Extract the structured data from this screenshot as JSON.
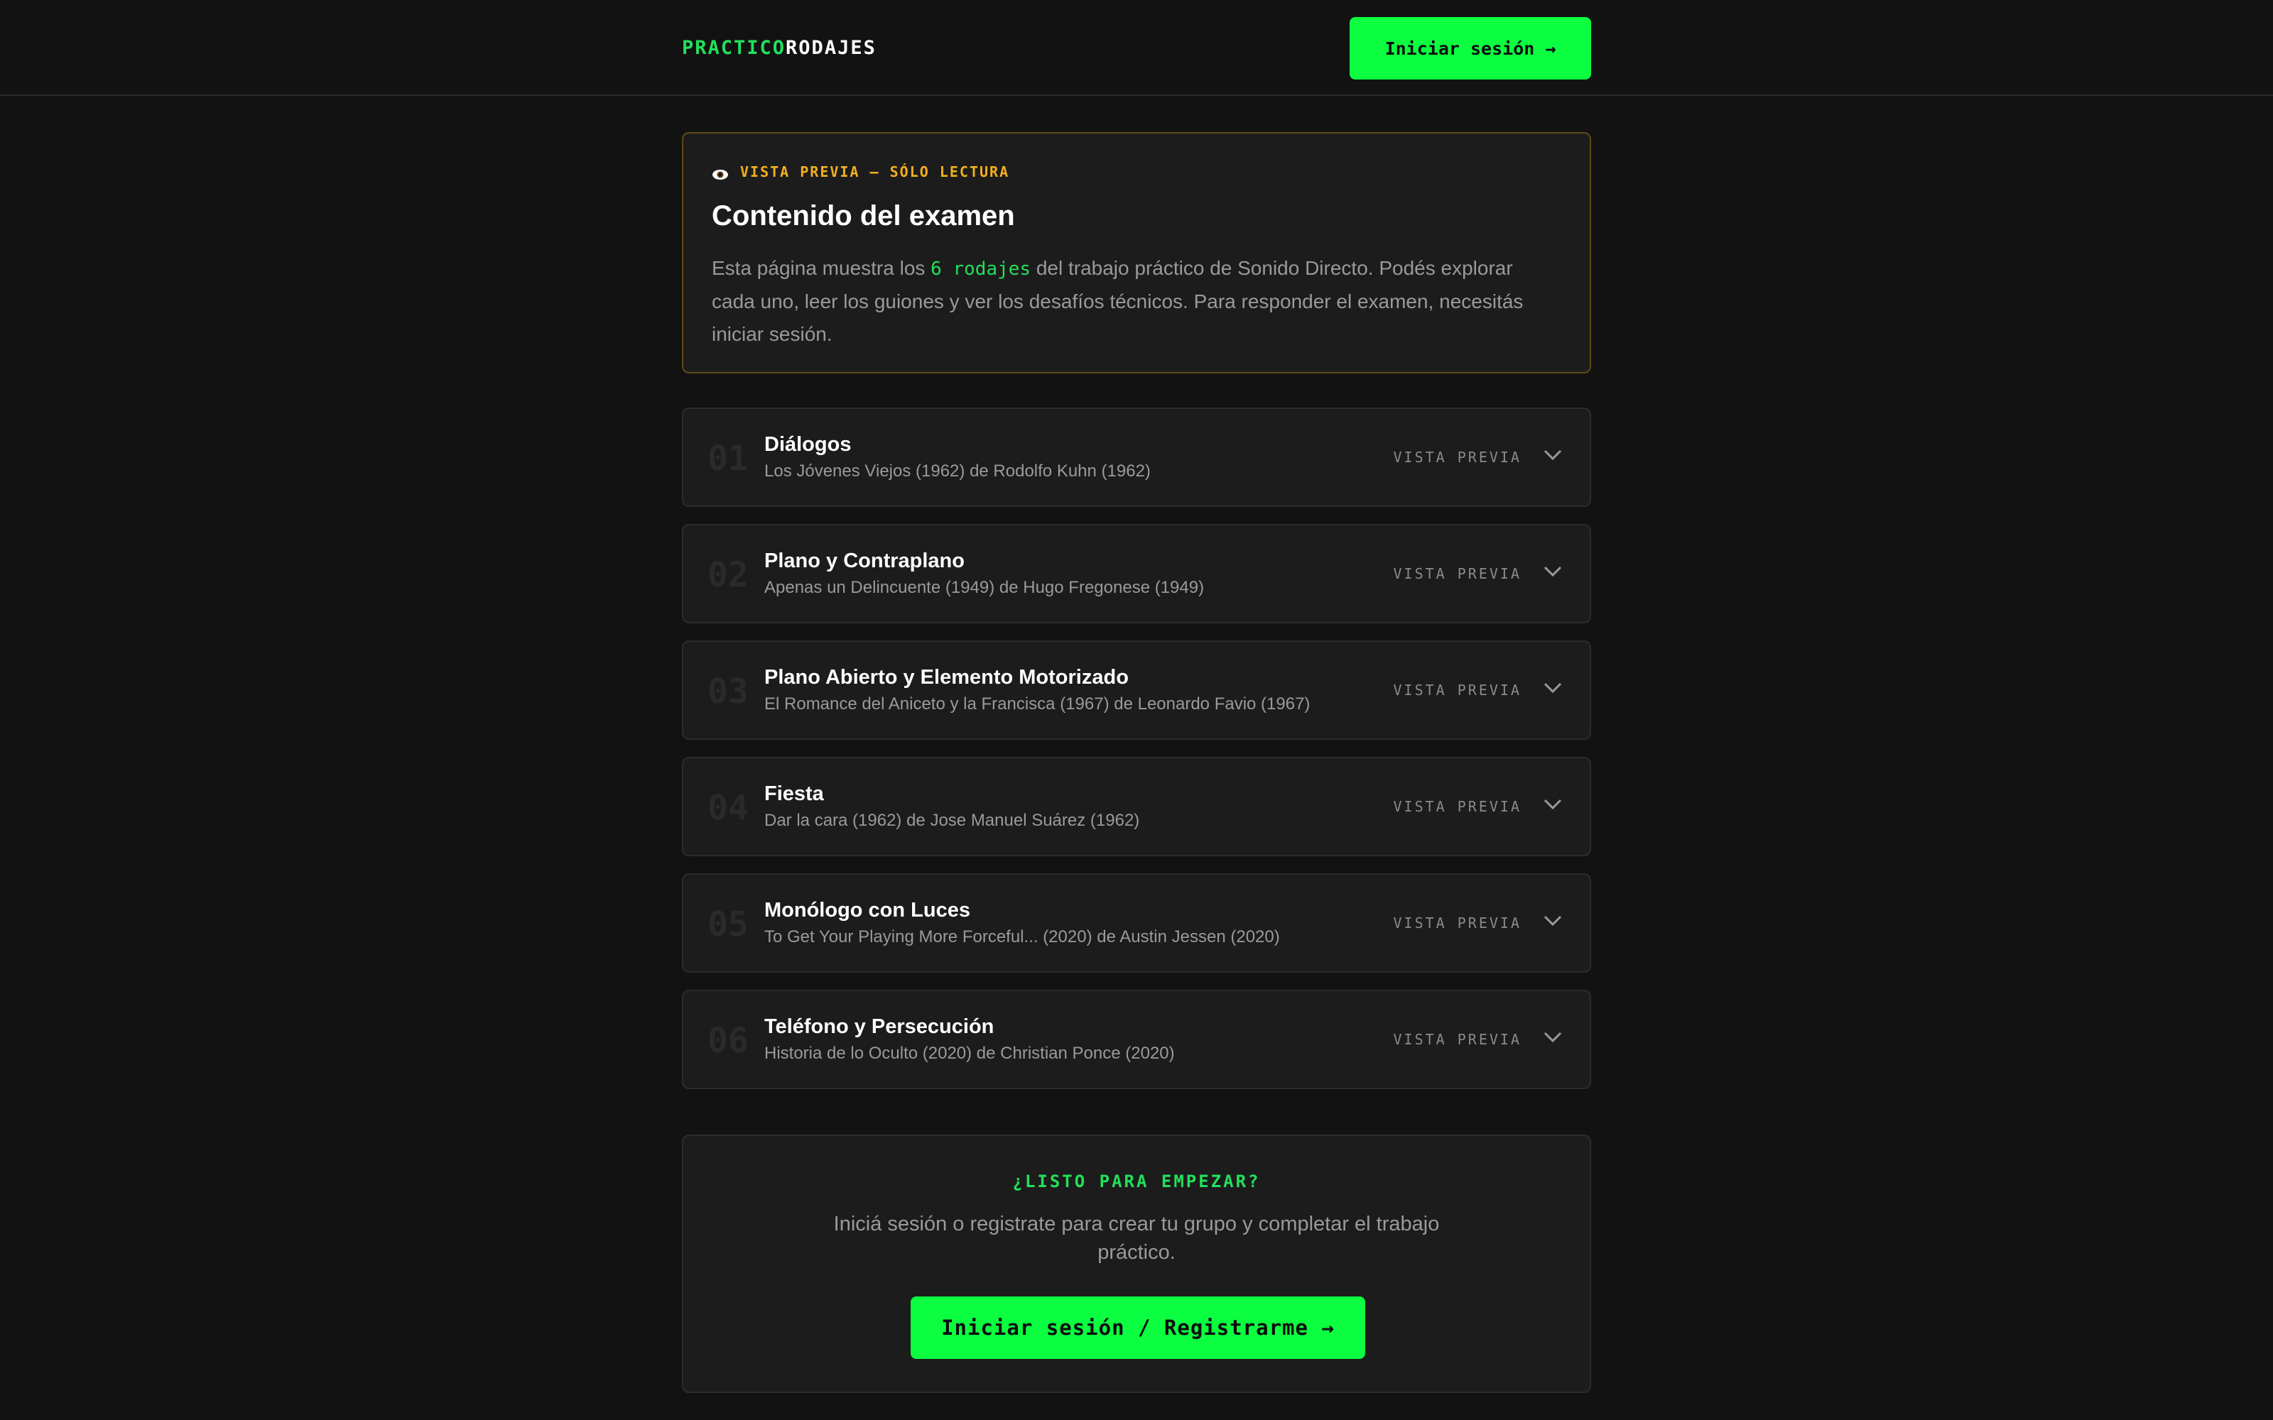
{
  "header": {
    "logo_part1": "PRACTICO",
    "logo_part2": "RODAJES",
    "login_label": "Iniciar sesión →"
  },
  "preview": {
    "tag": "VISTA PREVIA — SÓLO LECTURA",
    "tag_icon": "eye-icon",
    "title": "Contenido del examen",
    "desc_before": "Esta página muestra los ",
    "desc_highlight": "6 rodajes",
    "desc_after": " del trabajo práctico de Sonido Directo. Podés explorar cada uno, leer los guiones y ver los desafíos técnicos. Para responder el examen, necesitás iniciar sesión."
  },
  "items": [
    {
      "num": "01",
      "title": "Diálogos",
      "subtitle": "Los Jóvenes Viejos (1962) de Rodolfo Kuhn (1962)",
      "tag": "VISTA PREVIA"
    },
    {
      "num": "02",
      "title": "Plano y Contraplano",
      "subtitle": "Apenas un Delincuente (1949) de Hugo Fregonese (1949)",
      "tag": "VISTA PREVIA"
    },
    {
      "num": "03",
      "title": "Plano Abierto y Elemento Motorizado",
      "subtitle": "El Romance del Aniceto y la Francisca (1967) de Leonardo Favio (1967)",
      "tag": "VISTA PREVIA"
    },
    {
      "num": "04",
      "title": "Fiesta",
      "subtitle": "Dar la cara (1962) de Jose Manuel Suárez (1962)",
      "tag": "VISTA PREVIA"
    },
    {
      "num": "05",
      "title": "Monólogo con Luces",
      "subtitle": "To Get Your Playing More Forceful... (2020) de Austin Jessen (2020)",
      "tag": "VISTA PREVIA"
    },
    {
      "num": "06",
      "title": "Teléfono y Persecución",
      "subtitle": "Historia de lo Oculto (2020) de Christian Ponce (2020)",
      "tag": "VISTA PREVIA"
    }
  ],
  "cta": {
    "kicker": "¿LISTO PARA EMPEZAR?",
    "text": "Iniciá sesión o registrate para crear tu grupo y completar el trabajo práctico.",
    "button_label": "Iniciar sesión / Registrarme →"
  },
  "colors": {
    "background": "#121212",
    "card": "#1c1c1c",
    "accent_green": "#0bff40",
    "highlight_green": "#22e05a",
    "warning_amber": "#f2b01e"
  }
}
